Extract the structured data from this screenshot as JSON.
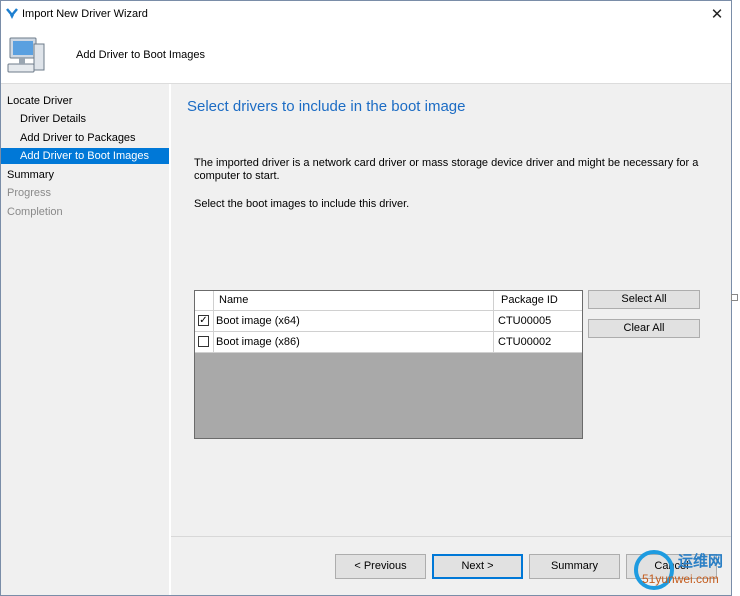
{
  "window": {
    "title": "Import New Driver Wizard",
    "close_glyph": "✕"
  },
  "header": {
    "step_title": "Add Driver to Boot Images",
    "icon": "computer-icon"
  },
  "sidebar": {
    "items": [
      {
        "label": "Locate Driver",
        "state": "normal"
      },
      {
        "label": "Driver Details",
        "state": "normal"
      },
      {
        "label": "Add Driver to Packages",
        "state": "normal"
      },
      {
        "label": "Add Driver to Boot Images",
        "state": "selected"
      },
      {
        "label": "Summary",
        "state": "normal"
      },
      {
        "label": "Progress",
        "state": "disabled"
      },
      {
        "label": "Completion",
        "state": "disabled"
      }
    ]
  },
  "main": {
    "heading": "Select drivers to include in the boot image",
    "description": "The imported driver is a network card driver or mass storage device driver and might be necessary for a computer to start.",
    "instruction": "Select the boot images to include this driver.",
    "table": {
      "columns": [
        "Name",
        "Package ID"
      ],
      "rows": [
        {
          "checked": true,
          "check_glyph": "✓",
          "name": "Boot image (x64)",
          "package_id": "CTU00005"
        },
        {
          "checked": false,
          "check_glyph": "",
          "name": "Boot image (x86)",
          "package_id": "CTU00002"
        }
      ]
    },
    "select_all_label": "Select All",
    "clear_all_label": "Clear All"
  },
  "footer": {
    "previous_label": "< Previous",
    "next_label": "Next >",
    "summary_label": "Summary",
    "cancel_label": "Cancel"
  },
  "watermark": {
    "top_text": "运维网",
    "bottom_text": "51yunwei.com"
  },
  "colors": {
    "accent": "#0078d7",
    "heading": "#1c6cc4",
    "panel": "#f0f0f0",
    "grid_empty": "#a9a9a9"
  }
}
